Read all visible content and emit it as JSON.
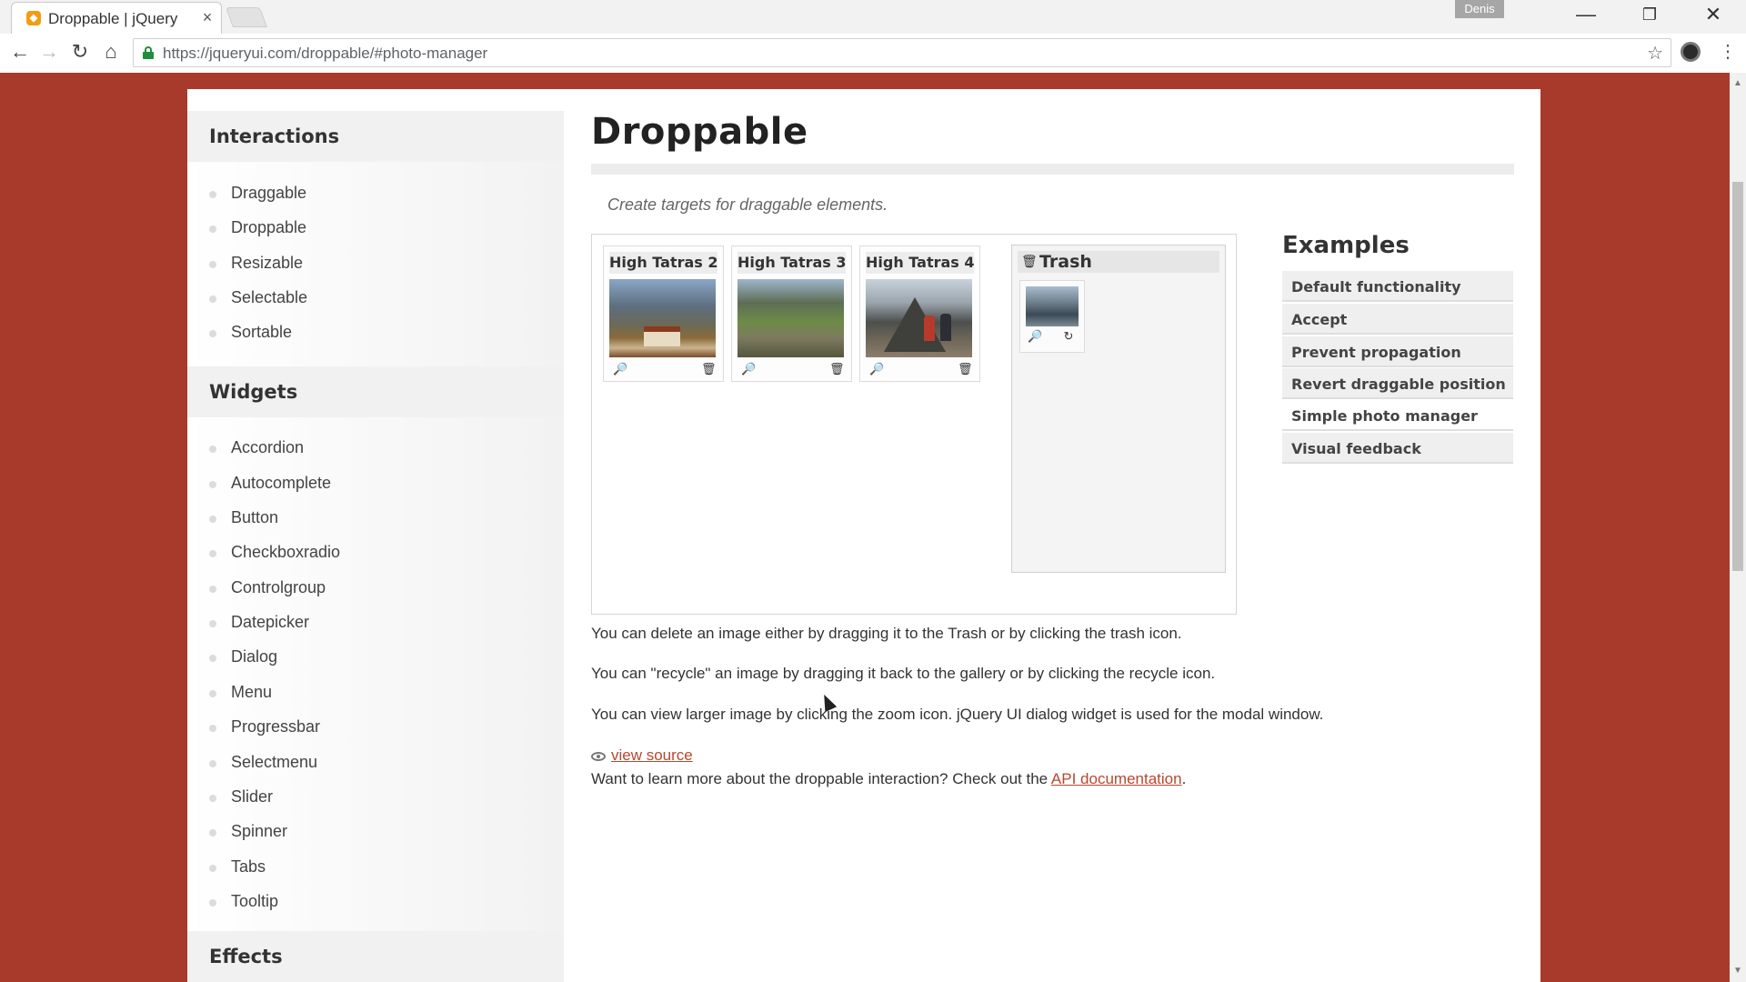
{
  "browser": {
    "tab_title": "Droppable | jQuery",
    "tab_close": "×",
    "user_badge": "Denis",
    "url": "https://jqueryui.com/droppable/#photo-manager",
    "buttons": {
      "back": "←",
      "forward": "→",
      "reload": "↻",
      "home": "⌂",
      "star": "☆",
      "menu": "⋮",
      "minimize": "—",
      "restore": "❐",
      "close": "✕"
    }
  },
  "sidebar": {
    "interactions_heading": "Interactions",
    "interactions": [
      "Draggable",
      "Droppable",
      "Resizable",
      "Selectable",
      "Sortable"
    ],
    "widgets_heading": "Widgets",
    "widgets": [
      "Accordion",
      "Autocomplete",
      "Button",
      "Checkboxradio",
      "Controlgroup",
      "Datepicker",
      "Dialog",
      "Menu",
      "Progressbar",
      "Selectmenu",
      "Slider",
      "Spinner",
      "Tabs",
      "Tooltip"
    ],
    "effects_heading": "Effects"
  },
  "main": {
    "title": "Droppable",
    "subtitle": "Create targets for draggable elements.",
    "gallery": [
      {
        "title": "High Tatras 2"
      },
      {
        "title": "High Tatras 3"
      },
      {
        "title": "High Tatras 4"
      }
    ],
    "trash_title": "Trash",
    "icons": {
      "zoom": "🔎",
      "trash": "🗑",
      "recycle": "↻"
    },
    "para_delete": "You can delete an image either by dragging it to the Trash or by clicking the trash icon.",
    "para_recycle": "You can \"recycle\" an image by dragging it back to the gallery or by clicking the recycle icon.",
    "para_zoom": "You can view larger image by clicking the zoom icon. jQuery UI dialog widget is used for the modal window.",
    "view_source": "view source",
    "learn_more_prefix": "Want to learn more about the droppable interaction? Check out the ",
    "api_link": "API documentation",
    "learn_more_suffix": "."
  },
  "examples": {
    "title": "Examples",
    "items": [
      "Default functionality",
      "Accept",
      "Prevent propagation",
      "Revert draggable position",
      "Simple photo manager",
      "Visual feedback"
    ],
    "active_index": 4
  },
  "colors": {
    "brand": "#a83a2c",
    "link": "#b9472d"
  }
}
